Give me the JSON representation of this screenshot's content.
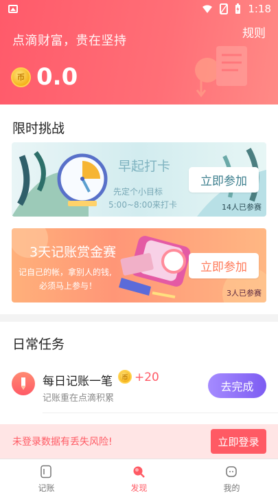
{
  "status_bar": {
    "time": "1:18"
  },
  "header": {
    "slogan": "点滴财富，贵在坚持",
    "rules_label": "规则",
    "coin_symbol": "币",
    "balance": "0.0"
  },
  "challenge": {
    "title": "限时挑战",
    "banners": [
      {
        "title": "早起打卡",
        "subtitle_line1": "先定个小目标",
        "subtitle_line2": "5:00~8:00来打卡",
        "button_label": "立即参加",
        "participants": "14人已参赛"
      },
      {
        "title": "3天记账赏金赛",
        "subtitle_line1": "记自己的帐，拿别人的钱,",
        "subtitle_line2": "必须马上参与！",
        "button_label": "立即参加",
        "participants": "3人已参赛"
      }
    ]
  },
  "daily": {
    "title": "日常任务",
    "task": {
      "title": "每日记账一笔",
      "reward": "+20",
      "description": "记账重在点滴积累",
      "button_label": "去完成"
    }
  },
  "login_bar": {
    "message": "未登录数据有丢失风险!",
    "button_label": "立即登录"
  },
  "bottom_nav": {
    "items": [
      {
        "label": "记账"
      },
      {
        "label": "发现"
      },
      {
        "label": "我的"
      }
    ]
  },
  "colors": {
    "brand_red": "#ff5a64",
    "purple_button": "#7d5cf2"
  }
}
